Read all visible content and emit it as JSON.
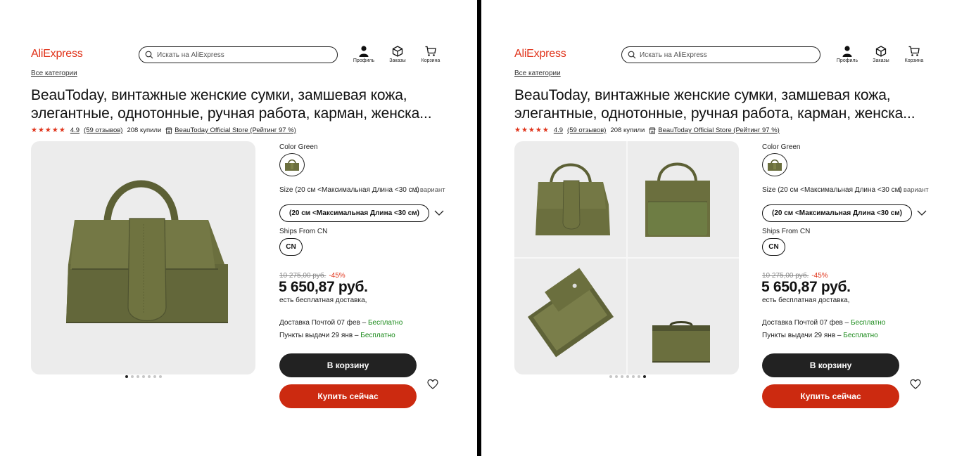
{
  "brand": {
    "logo": "AliExpress",
    "accent": "#e0331a"
  },
  "search": {
    "placeholder": "Искать на AliExpress"
  },
  "header_icons": [
    {
      "icon": "profile-icon",
      "label": "Профиль"
    },
    {
      "icon": "orders-icon",
      "label": "Заказы"
    },
    {
      "icon": "cart-icon",
      "label": "Корзина"
    }
  ],
  "breadcrumb": "Все категории",
  "product": {
    "title": "BeauToday, винтажные женские сумки, замшевая кожа, элегантные, однотонные, ручная работа, карман, женска...",
    "stars": "★★★★★",
    "rating": "4.9",
    "reviews": "(59 отзывов)",
    "sold": "208 купили",
    "store": "BeauToday Official Store (Рейтинг 97 %)",
    "color_label": "Color Green",
    "size_label": "Size (20 см <Максимальная Длина <30 см)",
    "size_variants": "1 вариант",
    "size_option": "(20 см <Максимальная Длина <30 см)",
    "ships_label": "Ships From CN",
    "ships_option": "CN",
    "old_price": "10 275,00 руб.",
    "discount": "-45%",
    "price": "5 650,87 руб.",
    "free_shipping": "есть бесплатная доставка,",
    "delivery_post": "Доставка Почтой 07 фев –",
    "delivery_post_cost": "Бесплатно",
    "delivery_pickup": "Пункты выдачи 29 янв –",
    "delivery_pickup_cost": "Бесплатно",
    "add_to_cart": "В корзину",
    "buy_now": "Купить сейчас"
  },
  "gallery": {
    "total": 7,
    "left_active": 1,
    "right_active": 7
  },
  "colors": {
    "bag": "#6b6f3e",
    "bag_dark": "#4f5330",
    "bag_light": "#7d8248",
    "panel_bg": "#ececec",
    "buy": "#cc2a10",
    "cart_btn": "#222222",
    "free_text": "#1a8a1a"
  }
}
